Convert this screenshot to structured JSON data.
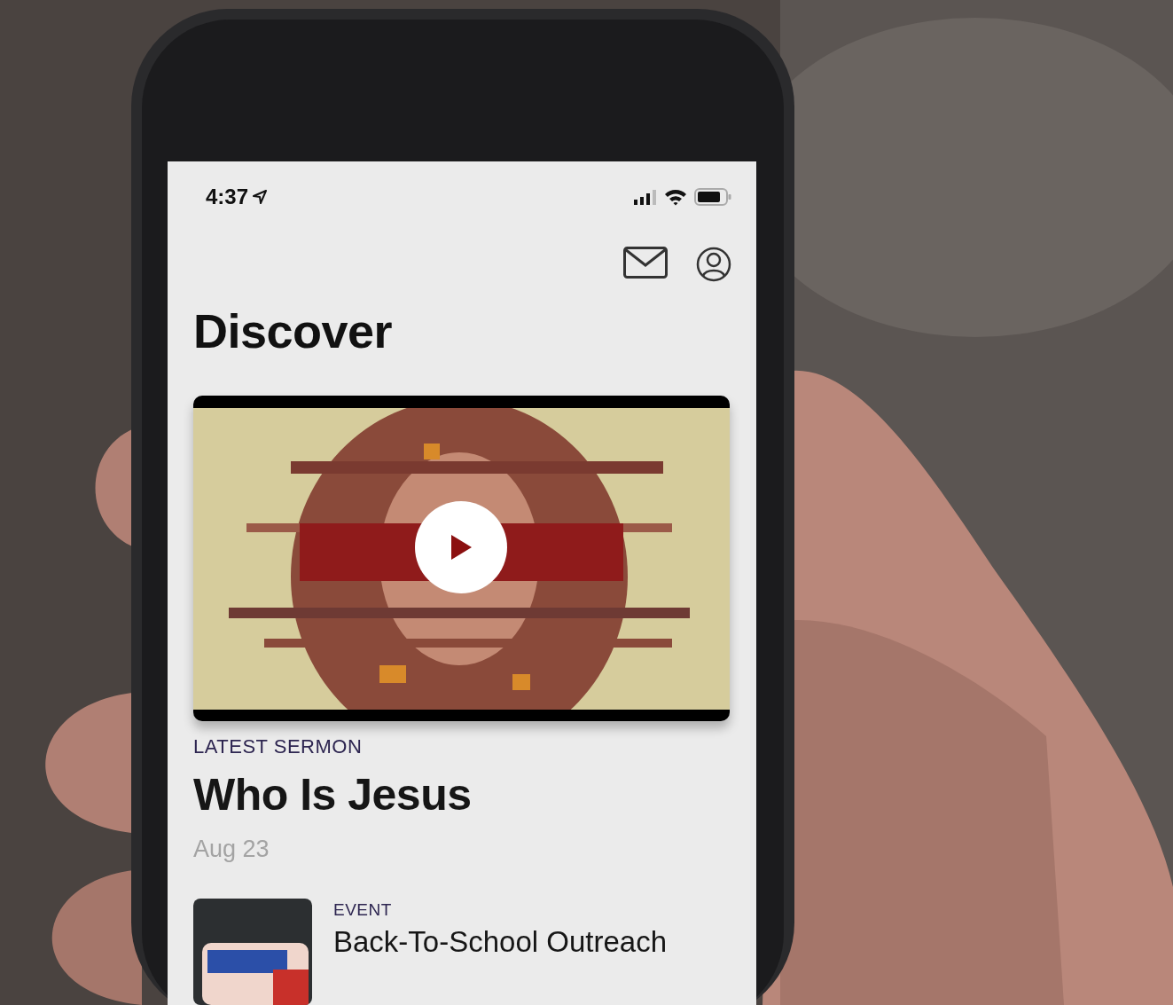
{
  "status_bar": {
    "time": "4:37"
  },
  "page": {
    "title": "Discover"
  },
  "featured": {
    "label": "LATEST SERMON",
    "title": "Who Is Jesus",
    "date": "Aug 23"
  },
  "items": [
    {
      "category": "EVENT",
      "title": "Back-To-School Outreach"
    }
  ]
}
